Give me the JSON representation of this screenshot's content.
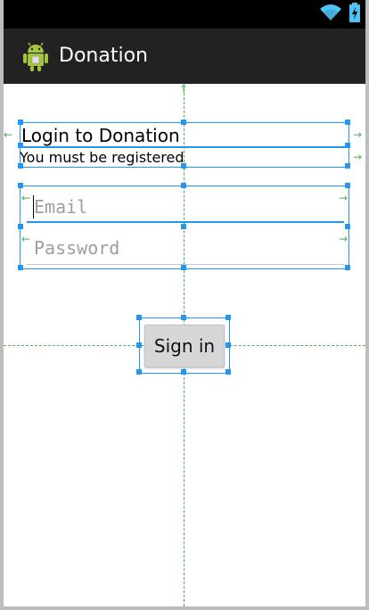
{
  "app": {
    "title": "Donation",
    "icon_name": "android-robot-icon"
  },
  "status_bar": {
    "icons": [
      "wifi-icon",
      "battery-charging-icon"
    ]
  },
  "login": {
    "title": "Login to Donation",
    "subtitle": "You must be registered",
    "email": {
      "value": "",
      "placeholder": "Email"
    },
    "password": {
      "value": "",
      "placeholder": "Password"
    },
    "signin_label": "Sign in"
  },
  "colors": {
    "status_bar": "#000000",
    "action_bar": "#222222",
    "selection": "#2196f3",
    "guide": "#4caf50",
    "button": "#d6d6d6"
  }
}
